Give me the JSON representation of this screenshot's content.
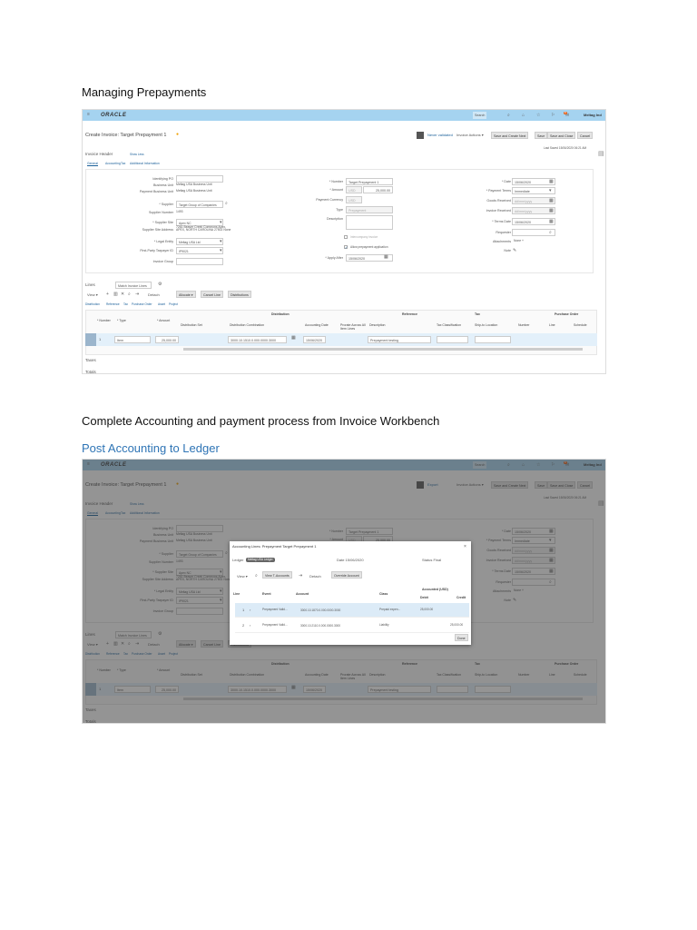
{
  "doc": {
    "heading1": "Managing Prepayments",
    "heading2": "Complete Accounting and payment process from Invoice Workbench",
    "heading3": "Post Accounting to Ledger"
  },
  "app": {
    "logo": "ORACLE",
    "search_placeholder": "Search",
    "user": "Meltag Ind",
    "notif_count": "8"
  },
  "invoice": {
    "title": "Create Invoice: Target Prepayment 1",
    "toolbar": {
      "status": "Never validated",
      "status2": "Export",
      "actions": "Invoice Actions ▾",
      "save_next": "Save and Create Next",
      "save": "Save",
      "save_close": "Save and Close",
      "cancel": "Cancel"
    },
    "last_saved": "Last Saved 15/06/2020 06:21 AM",
    "header_label": "Invoice Header",
    "show_less": "Show Less",
    "tabs": [
      "General",
      "Accounting",
      "Tax",
      "Additional Information"
    ],
    "left": [
      {
        "label": "Identifying PO",
        "value": ""
      },
      {
        "label": "Business Unit",
        "value": "Meltag USA Business Unit"
      },
      {
        "label": "Payment Business Unit",
        "value": "Meltag USA Business Unit"
      },
      {
        "label": "* Supplier",
        "value": "Target Group of Companies"
      },
      {
        "label": "Supplier Number",
        "value": "1493"
      },
      {
        "label": "* Supplier Site",
        "value": "Apex NC"
      },
      {
        "label": "Supplier Site Address",
        "value": "7261 Beaver Creek Commons Apex, APEX, NORTH CAROLINA 27502 None"
      },
      {
        "label": "* Legal Entity",
        "value": "Meltag USA Ltd"
      },
      {
        "label": "First-Party Taxpayer ID",
        "value": "IP9021"
      },
      {
        "label": "Invoice Group",
        "value": ""
      }
    ],
    "mid": [
      {
        "label": "* Number",
        "value": "Target Prepayment 1"
      },
      {
        "label": "* Amount",
        "value": "USD",
        "value2": "25,000.00"
      },
      {
        "label": "Payment Currency",
        "value": "USD"
      },
      {
        "label": "Type",
        "value": "Prepayment"
      },
      {
        "label": "Description",
        "value": ""
      },
      {
        "label": "",
        "value": "Intercompany invoice"
      },
      {
        "label": "",
        "value": "Allow prepayment application"
      },
      {
        "label": "* Apply After",
        "value": "15/06/2020"
      }
    ],
    "right": [
      {
        "label": "* Date",
        "value": "15/06/2020"
      },
      {
        "label": "* Payment Terms",
        "value": "Immediate"
      },
      {
        "label": "Goods Received",
        "value": "dd/mm/yyyy"
      },
      {
        "label": "Invoice Received",
        "value": "dd/mm/yyyy"
      },
      {
        "label": "* Terms Date",
        "value": "15/06/2020"
      },
      {
        "label": "Requester",
        "value": ""
      },
      {
        "label": "Attachments",
        "value": "None +"
      },
      {
        "label": "Note",
        "value": ""
      }
    ],
    "lines": {
      "label": "Lines",
      "match": "Match Invoice Lines",
      "view": "View ▾",
      "detach": "Detach",
      "allocate": "Allocate ▾",
      "cancel_line": "Cancel Line",
      "distributions": "Distributions",
      "tabs": [
        "Distribution",
        "Reference",
        "Tax",
        "Purchase Order",
        "Asset",
        "Project"
      ],
      "groups": [
        "Distribution",
        "Reference",
        "Tax",
        "Purchase Order"
      ],
      "columns": [
        "* Number",
        "* Type",
        "* Amount",
        "Distribution Set",
        "Distribution Combination",
        "Accounting Date",
        "Prorate Across All Item Lines",
        "Description",
        "Tax Classification",
        "Ship-to Location",
        "Number",
        "Line",
        "Schedule"
      ],
      "row": {
        "number": "1",
        "type": "Item",
        "amount": "25,000.00",
        "combination": "3000.10.1510.0.000.0000.3000",
        "acct_date": "15/06/2020",
        "description": "Prepayment testing"
      }
    },
    "taxes": "Taxes",
    "totals": "Totals"
  },
  "dialog": {
    "title": "Accounting Lines: Prepayment Target Prepayment 1",
    "close": "×",
    "ledger_label": "Ledger",
    "ledger": "Meltag USA Ledger",
    "date": "Date 15/06/2020",
    "status": "Status Final",
    "view": "View ▾",
    "view_accounts": "View T-Accounts",
    "detach": "Detach",
    "override": "Override Account",
    "headers": {
      "line": "Line",
      "event": "Event",
      "account": "Account",
      "class": "Class",
      "accounted": "Accounted (USD)",
      "debit": "Debit",
      "credit": "Credit"
    },
    "rows": [
      {
        "line": "1",
        "event": "Prepayment Valid...",
        "account": "3000.10.1870.0.000.0000.3000",
        "class": "Prepaid expen...",
        "debit": "25,000.00",
        "credit": ""
      },
      {
        "line": "2",
        "event": "Prepayment Valid...",
        "account": "3000.10.2110.0.000.0000.3000",
        "class": "Liability",
        "debit": "",
        "credit": "25,000.00"
      }
    ],
    "done": "Done"
  },
  "colors": {
    "bar": "#a5d3f0",
    "link": "#1a5f99",
    "heading_blue": "#2e74b5"
  }
}
